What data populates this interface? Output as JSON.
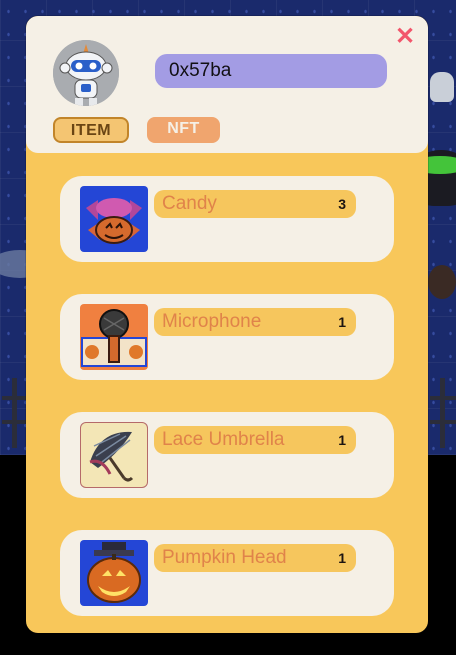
{
  "profile": {
    "address": "0x57ba"
  },
  "tabs": [
    {
      "label": "ITEM",
      "active": true
    },
    {
      "label": "NFT",
      "active": false
    }
  ],
  "close_symbol": "✕",
  "items": [
    {
      "name": "Candy",
      "quantity": "3",
      "icon": "candy-icon"
    },
    {
      "name": "Microphone",
      "quantity": "1",
      "icon": "microphone-icon"
    },
    {
      "name": "Lace Umbrella",
      "quantity": "1",
      "icon": "lace-umbrella-icon"
    },
    {
      "name": "Pumpkin Head",
      "quantity": "1",
      "icon": "pumpkin-head-icon"
    }
  ],
  "colors": {
    "panel": "#f8c75a",
    "card": "#f5f0e6",
    "address_pill": "#a39ce4",
    "close": "#f2556b",
    "item_name": "#e0834a"
  }
}
